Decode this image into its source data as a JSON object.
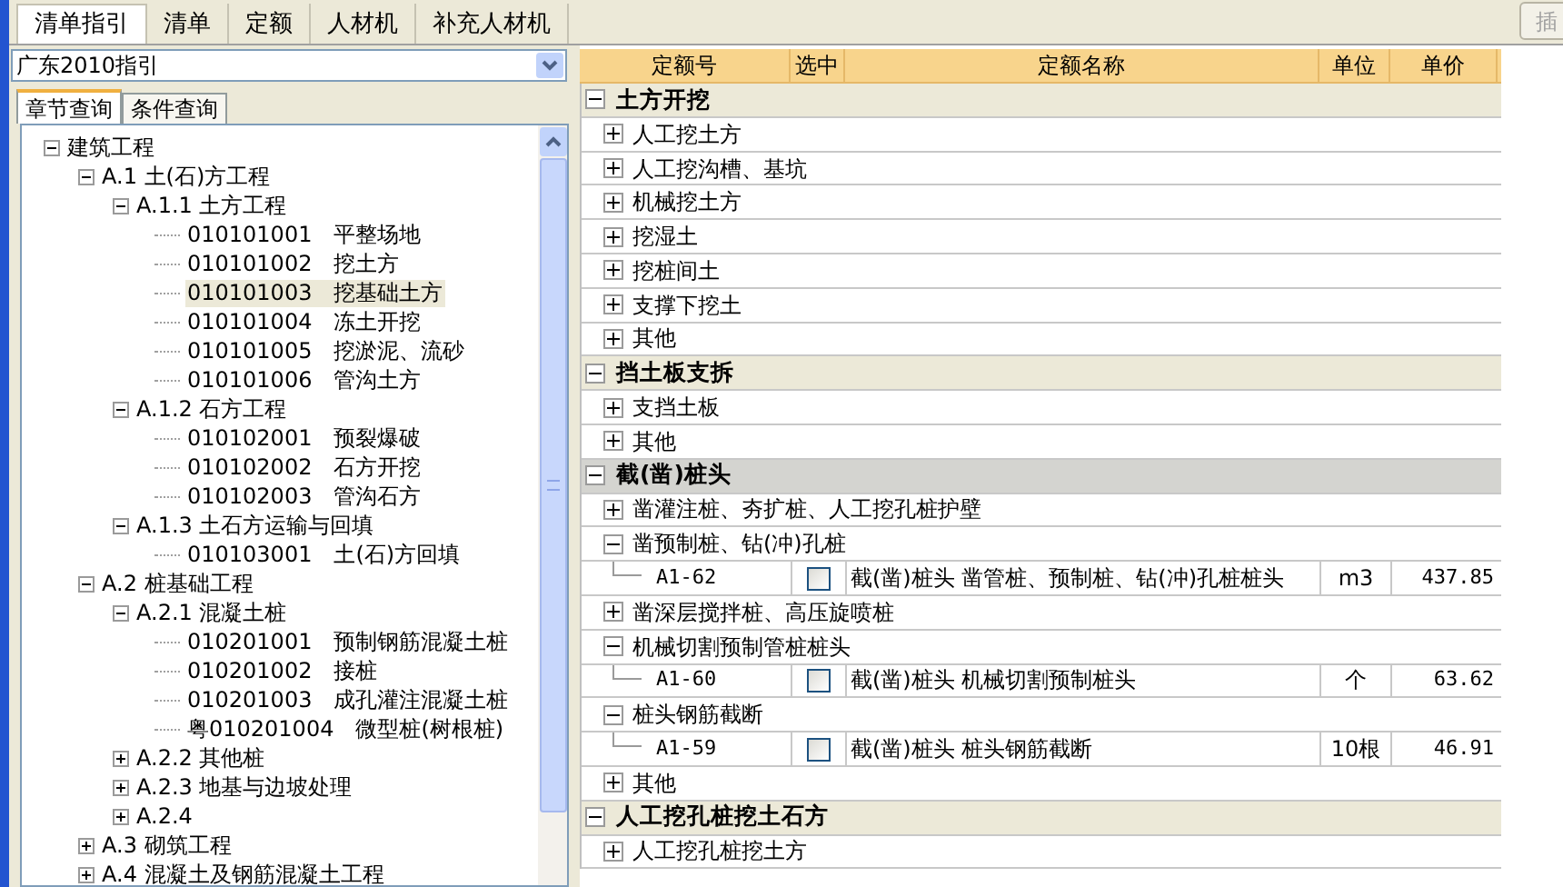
{
  "top_tabs": [
    {
      "label": "清单指引",
      "selected": true
    },
    {
      "label": "清单",
      "selected": false
    },
    {
      "label": "定额",
      "selected": false
    },
    {
      "label": "人材机",
      "selected": false
    },
    {
      "label": "补充人材机",
      "selected": false
    }
  ],
  "insert_button": {
    "label": "插",
    "disabled": true
  },
  "guide_select": {
    "value": "广东2010指引"
  },
  "query_tabs": [
    {
      "label": "章节查询",
      "selected": true
    },
    {
      "label": "条件查询",
      "selected": false
    }
  ],
  "tree": [
    {
      "label": "建筑工程",
      "expanded": true,
      "selected": false,
      "children": [
        {
          "label": "A.1 土(石)方工程",
          "expanded": true,
          "selected": false,
          "children": [
            {
              "label": "A.1.1 土方工程",
              "expanded": true,
              "selected": false,
              "children": [
                {
                  "code": "010101001",
                  "label": "平整场地",
                  "selected": false
                },
                {
                  "code": "010101002",
                  "label": "挖土方",
                  "selected": false
                },
                {
                  "code": "010101003",
                  "label": "挖基础土方",
                  "selected": true
                },
                {
                  "code": "010101004",
                  "label": "冻土开挖",
                  "selected": false
                },
                {
                  "code": "010101005",
                  "label": "挖淤泥、流砂",
                  "selected": false
                },
                {
                  "code": "010101006",
                  "label": "管沟土方",
                  "selected": false
                }
              ]
            },
            {
              "label": "A.1.2 石方工程",
              "expanded": true,
              "selected": false,
              "children": [
                {
                  "code": "010102001",
                  "label": "预裂爆破",
                  "selected": false
                },
                {
                  "code": "010102002",
                  "label": "石方开挖",
                  "selected": false
                },
                {
                  "code": "010102003",
                  "label": "管沟石方",
                  "selected": false
                }
              ]
            },
            {
              "label": "A.1.3 土石方运输与回填",
              "expanded": true,
              "selected": false,
              "children": [
                {
                  "code": "010103001",
                  "label": "土(石)方回填",
                  "selected": false
                }
              ]
            }
          ]
        },
        {
          "label": "A.2 桩基础工程",
          "expanded": true,
          "selected": false,
          "children": [
            {
              "label": "A.2.1 混凝土桩",
              "expanded": true,
              "selected": false,
              "children": [
                {
                  "code": "010201001",
                  "label": "预制钢筋混凝土桩",
                  "selected": false
                },
                {
                  "code": "010201002",
                  "label": "接桩",
                  "selected": false
                },
                {
                  "code": "010201003",
                  "label": "成孔灌注混凝土桩",
                  "selected": false
                },
                {
                  "code": "粤010201004",
                  "label": "微型桩(树根桩)",
                  "selected": false
                }
              ]
            },
            {
              "label": "A.2.2 其他桩",
              "expanded": false,
              "selected": false
            },
            {
              "label": "A.2.3 地基与边坡处理",
              "expanded": false,
              "selected": false
            },
            {
              "label": "A.2.4",
              "expanded": false,
              "selected": false
            }
          ]
        },
        {
          "label": "A.3 砌筑工程",
          "expanded": false,
          "selected": false
        },
        {
          "label": "A.4 混凝土及钢筋混凝土工程",
          "expanded": false,
          "selected": false
        }
      ]
    }
  ],
  "table": {
    "columns": [
      "定额号",
      "选中",
      "定额名称",
      "单位",
      "单价"
    ],
    "rows": [
      {
        "kind": "section",
        "label": "土方开挖",
        "expanded": true,
        "selected": false
      },
      {
        "kind": "group",
        "label": "人工挖土方",
        "expanded": false
      },
      {
        "kind": "group",
        "label": "人工挖沟槽、基坑",
        "expanded": false
      },
      {
        "kind": "group",
        "label": "机械挖土方",
        "expanded": false
      },
      {
        "kind": "group",
        "label": "挖湿土",
        "expanded": false
      },
      {
        "kind": "group",
        "label": "挖桩间土",
        "expanded": false
      },
      {
        "kind": "group",
        "label": "支撑下挖土",
        "expanded": false
      },
      {
        "kind": "group",
        "label": "其他",
        "expanded": false
      },
      {
        "kind": "section",
        "label": "挡土板支拆",
        "expanded": true,
        "selected": false
      },
      {
        "kind": "group",
        "label": "支挡土板",
        "expanded": false
      },
      {
        "kind": "group",
        "label": "其他",
        "expanded": false
      },
      {
        "kind": "section",
        "label": "截(凿)桩头",
        "expanded": true,
        "selected": true
      },
      {
        "kind": "group",
        "label": "凿灌注桩、夯扩桩、人工挖孔桩护壁",
        "expanded": false
      },
      {
        "kind": "group",
        "label": "凿预制桩、钻(冲)孔桩",
        "expanded": true
      },
      {
        "kind": "item",
        "code": "A1-62",
        "checked": false,
        "name": "截(凿)桩头 凿管桩、预制桩、钻(冲)孔桩桩头",
        "unit": "m3",
        "price": "437.85"
      },
      {
        "kind": "group",
        "label": "凿深层搅拌桩、高压旋喷桩",
        "expanded": false
      },
      {
        "kind": "group",
        "label": "机械切割预制管桩桩头",
        "expanded": true
      },
      {
        "kind": "item",
        "code": "A1-60",
        "checked": false,
        "name": "截(凿)桩头 机械切割预制桩头",
        "unit": "个",
        "price": "63.62"
      },
      {
        "kind": "group",
        "label": "桩头钢筋截断",
        "expanded": true
      },
      {
        "kind": "item",
        "code": "A1-59",
        "checked": false,
        "name": "截(凿)桩头 桩头钢筋截断",
        "unit": "10根",
        "price": "46.91"
      },
      {
        "kind": "group",
        "label": "其他",
        "expanded": false
      },
      {
        "kind": "section",
        "label": "人工挖孔桩挖土石方",
        "expanded": true,
        "selected": false
      },
      {
        "kind": "group",
        "label": "人工挖孔桩挖土方",
        "expanded": false
      }
    ]
  }
}
